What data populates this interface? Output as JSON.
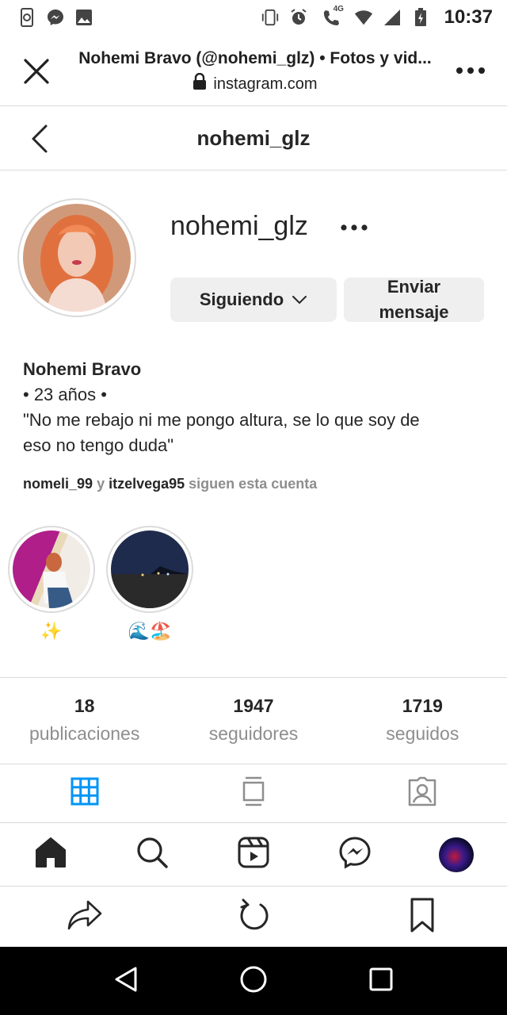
{
  "status_bar": {
    "time": "10:37",
    "icons": [
      "sync-phone-icon",
      "messenger-icon",
      "image-icon",
      "vibrate-icon",
      "alarm-icon",
      "wifi-calling-icon",
      "wifi-icon",
      "signal-icon",
      "battery-icon"
    ],
    "network_label": "4G"
  },
  "browser": {
    "title": "Nohemi Bravo (@nohemi_glz) • Fotos y vid...",
    "url": "instagram.com"
  },
  "ig_header": {
    "username": "nohemi_glz"
  },
  "profile": {
    "username": "nohemi_glz",
    "follow_button": "Siguiendo",
    "message_button_line1": "Enviar",
    "message_button_line2": "mensaje",
    "full_name": "Nohemi Bravo",
    "bio_line1": "• 23 años •",
    "bio_line2": "\"No me rebajo ni me pongo altura, se lo que soy de",
    "bio_line3": "eso no tengo duda\"",
    "followed_by_user1": "nomeli_99",
    "followed_by_conj": "y",
    "followed_by_user2": "itzelvega95",
    "followed_by_suffix": "siguen esta cuenta"
  },
  "highlights": [
    {
      "label": "✨"
    },
    {
      "label": "🌊🏖️"
    }
  ],
  "stats": [
    {
      "value": "18",
      "label": "publicaciones"
    },
    {
      "value": "1947",
      "label": "seguidores"
    },
    {
      "value": "1719",
      "label": "seguidos"
    }
  ],
  "colors": {
    "accent": "#0095f6",
    "text": "#262626",
    "muted": "#8e8e8e",
    "divider": "#dbdbdb",
    "button_bg": "#efefef"
  }
}
